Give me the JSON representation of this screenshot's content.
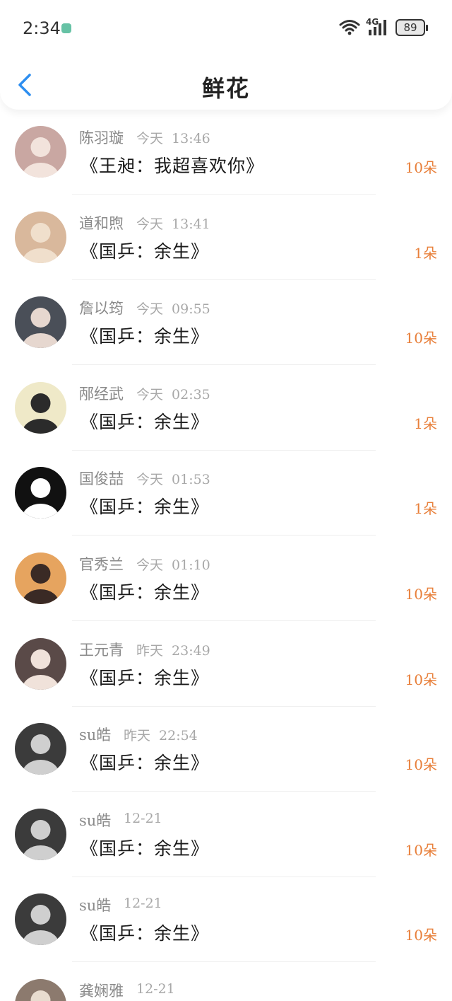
{
  "status_bar": {
    "time": "2:34",
    "network": "4G",
    "battery": "89"
  },
  "header": {
    "title": "鲜花"
  },
  "colors": {
    "accent_blue": "#2d8ef0",
    "count_orange": "#e87f3a"
  },
  "records": [
    {
      "name": "陈羽璇",
      "day": "今天",
      "time": "13:46",
      "gift": "《王昶：我超喜欢你》",
      "count": "10朵",
      "avatar_bg": "#c9a7a2",
      "avatar_fg": "#f2e3dc"
    },
    {
      "name": "道和煦",
      "day": "今天",
      "time": "13:41",
      "gift": "《国乒：余生》",
      "count": "1朵",
      "avatar_bg": "#d9b89c",
      "avatar_fg": "#f0dfcc"
    },
    {
      "name": "詹以筠",
      "day": "今天",
      "time": "09:55",
      "gift": "《国乒：余生》",
      "count": "10朵",
      "avatar_bg": "#4a4f58",
      "avatar_fg": "#e6d7cf"
    },
    {
      "name": "邴经武",
      "day": "今天",
      "time": "02:35",
      "gift": "《国乒：余生》",
      "count": "1朵",
      "avatar_bg": "#efe9c8",
      "avatar_fg": "#2b2b2b"
    },
    {
      "name": "国俊喆",
      "day": "今天",
      "time": "01:53",
      "gift": "《国乒：余生》",
      "count": "1朵",
      "avatar_bg": "#111111",
      "avatar_fg": "#ffffff"
    },
    {
      "name": "官秀兰",
      "day": "今天",
      "time": "01:10",
      "gift": "《国乒：余生》",
      "count": "10朵",
      "avatar_bg": "#e6a45f",
      "avatar_fg": "#3a2a25"
    },
    {
      "name": "王元青",
      "day": "昨天",
      "time": "23:49",
      "gift": "《国乒：余生》",
      "count": "10朵",
      "avatar_bg": "#5a4a48",
      "avatar_fg": "#f0e2da"
    },
    {
      "name": "su皓",
      "day": "昨天",
      "time": "22:54",
      "gift": "《国乒：余生》",
      "count": "10朵",
      "avatar_bg": "#3b3b3b",
      "avatar_fg": "#cfcfcf"
    },
    {
      "name": "su皓",
      "day": "",
      "time": "12-21",
      "gift": "《国乒：余生》",
      "count": "10朵",
      "avatar_bg": "#3b3b3b",
      "avatar_fg": "#cfcfcf"
    },
    {
      "name": "su皓",
      "day": "",
      "time": "12-21",
      "gift": "《国乒：余生》",
      "count": "10朵",
      "avatar_bg": "#3b3b3b",
      "avatar_fg": "#cfcfcf"
    },
    {
      "name": "龚娴雅",
      "day": "",
      "time": "12-21",
      "gift": "",
      "count": "",
      "avatar_bg": "#8c7a6e",
      "avatar_fg": "#e8dccf"
    }
  ]
}
